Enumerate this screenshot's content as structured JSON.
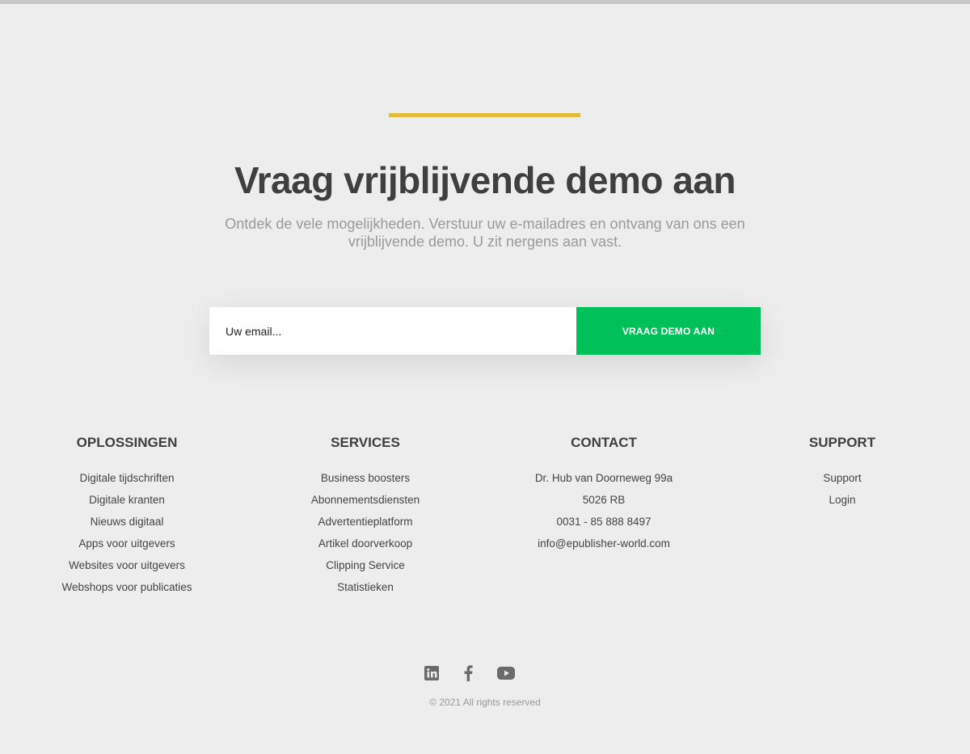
{
  "hero": {
    "title": "Vraag vrijblijvende demo aan",
    "subtitle": "Ontdek de vele mogelijkheden. Verstuur uw e-mailadres en ontvang van ons een vrijblijvende demo. U zit nergens aan vast.",
    "accent_color": "#e2bb3a"
  },
  "form": {
    "email_placeholder": "Uw email...",
    "button_label": "VRAAG DEMO AAN",
    "button_color": "#00c05a"
  },
  "footer": {
    "columns": [
      {
        "title": "OPLOSSINGEN",
        "items": [
          "Digitale tijdschriften",
          "Digitale kranten",
          "Nieuws digitaal",
          "Apps voor uitgevers",
          "Websites voor uitgevers",
          "Webshops voor publicaties"
        ]
      },
      {
        "title": "SERVICES",
        "items": [
          "Business boosters",
          "Abonnementsdiensten",
          "Advertentieplatform",
          "Artikel doorverkoop",
          "Clipping Service",
          "Statistieken"
        ]
      },
      {
        "title": "CONTACT",
        "items": [
          "Dr. Hub van Doorneweg 99a",
          "5026 RB",
          "0031 - 85 888 8497",
          "info@epublisher-world.com"
        ]
      },
      {
        "title": "SUPPORT",
        "items": [
          "Support",
          "Login"
        ]
      }
    ],
    "socials": [
      "linkedin-icon",
      "facebook-icon",
      "youtube-icon"
    ],
    "copyright": "© 2021 All rights reserved"
  }
}
